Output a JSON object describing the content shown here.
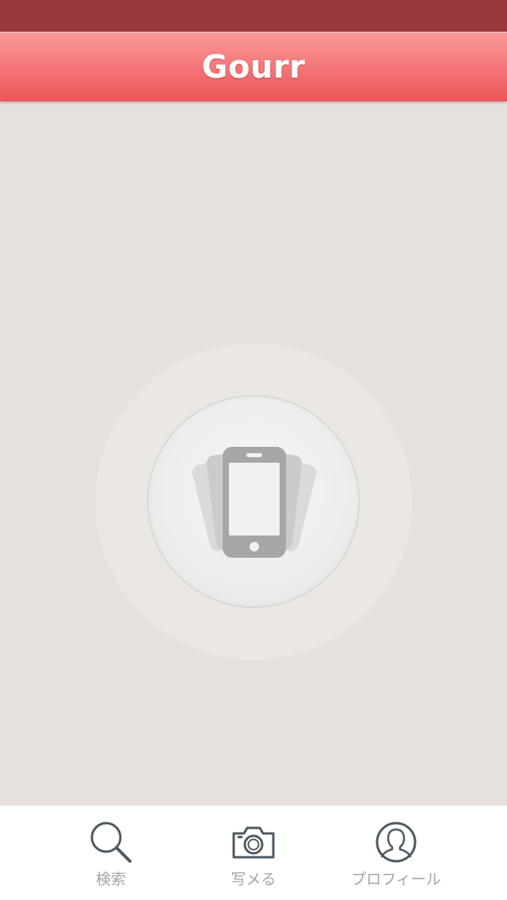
{
  "nav": {
    "title": "Gourr"
  },
  "tabs": [
    {
      "label": "検索",
      "icon": "search-icon"
    },
    {
      "label": "写メる",
      "icon": "camera-icon"
    },
    {
      "label": "プロフィール",
      "icon": "profile-icon"
    }
  ],
  "colors": {
    "status_bar": "#9a393c",
    "nav_bar": "#f47375",
    "background": "#e7e1dd",
    "icon_stroke": "#4e5a61",
    "tab_label": "#a5a5a5"
  }
}
